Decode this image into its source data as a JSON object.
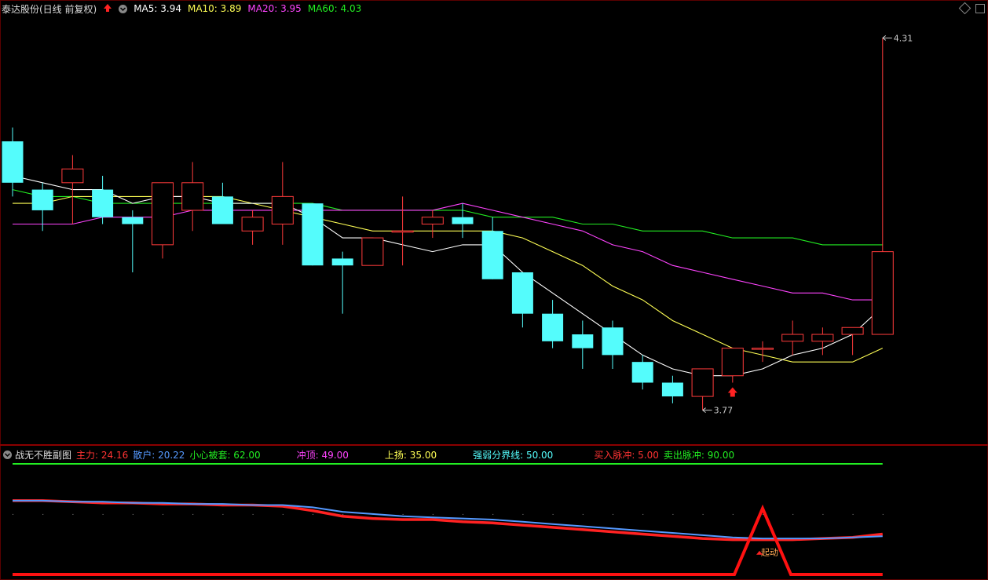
{
  "header": {
    "stock_title": "泰达股份(日线 前复权)",
    "ma5": "MA5: 3.94",
    "ma10": "MA10: 3.89",
    "ma20": "MA20: 3.95",
    "ma60": "MA60: 4.03",
    "colors": {
      "ma5": "#ffffff",
      "ma10": "#ffff55",
      "ma20": "#ff44ff",
      "ma60": "#22ee22"
    }
  },
  "main_chart": {
    "high_label": "4.31",
    "low_label": "3.77"
  },
  "sub_panel": {
    "title": "战无不胜副图",
    "indicators": [
      {
        "text": "主力: 24.16",
        "color": "#ff3333"
      },
      {
        "text": "散户: 20.22",
        "color": "#5599ff"
      },
      {
        "text": "小心被套: 62.00",
        "color": "#22ee22"
      },
      {
        "text": "冲顶: 49.00",
        "color": "#ff44ff"
      },
      {
        "text": "上扬: 35.00",
        "color": "#ffff55"
      },
      {
        "text": "强弱分界线: 50.00",
        "color": "#55ffff"
      },
      {
        "text": "买入脉冲: 5.00",
        "color": "#ff3333"
      },
      {
        "text": "卖出脉冲: 90.00",
        "color": "#22ee22"
      }
    ],
    "signal_label": "起动"
  },
  "chart_data": {
    "type": "candlestick",
    "candles": [
      {
        "o": 4.16,
        "h": 4.18,
        "l": 4.08,
        "c": 4.1
      },
      {
        "o": 4.09,
        "h": 4.1,
        "l": 4.03,
        "c": 4.06
      },
      {
        "o": 4.1,
        "h": 4.14,
        "l": 4.04,
        "c": 4.12
      },
      {
        "o": 4.09,
        "h": 4.11,
        "l": 4.04,
        "c": 4.05
      },
      {
        "o": 4.05,
        "h": 4.06,
        "l": 3.97,
        "c": 4.04
      },
      {
        "o": 4.01,
        "h": 4.07,
        "l": 3.99,
        "c": 4.1
      },
      {
        "o": 4.06,
        "h": 4.13,
        "l": 4.03,
        "c": 4.1
      },
      {
        "o": 4.08,
        "h": 4.1,
        "l": 4.04,
        "c": 4.04
      },
      {
        "o": 4.03,
        "h": 4.06,
        "l": 4.01,
        "c": 4.05
      },
      {
        "o": 4.04,
        "h": 4.13,
        "l": 4.01,
        "c": 4.08
      },
      {
        "o": 4.07,
        "h": 4.07,
        "l": 3.98,
        "c": 3.98
      },
      {
        "o": 3.99,
        "h": 4.0,
        "l": 3.91,
        "c": 3.98
      },
      {
        "o": 3.98,
        "h": 4.01,
        "l": 3.98,
        "c": 4.02
      },
      {
        "o": 4.03,
        "h": 4.08,
        "l": 3.98,
        "c": 4.03
      },
      {
        "o": 4.04,
        "h": 4.06,
        "l": 4.02,
        "c": 4.05
      },
      {
        "o": 4.05,
        "h": 4.07,
        "l": 4.02,
        "c": 4.04
      },
      {
        "o": 4.03,
        "h": 4.05,
        "l": 3.96,
        "c": 3.96
      },
      {
        "o": 3.97,
        "h": 3.97,
        "l": 3.89,
        "c": 3.91
      },
      {
        "o": 3.91,
        "h": 3.93,
        "l": 3.86,
        "c": 3.87
      },
      {
        "o": 3.88,
        "h": 3.9,
        "l": 3.83,
        "c": 3.86
      },
      {
        "o": 3.89,
        "h": 3.9,
        "l": 3.83,
        "c": 3.85
      },
      {
        "o": 3.84,
        "h": 3.85,
        "l": 3.8,
        "c": 3.81
      },
      {
        "o": 3.81,
        "h": 3.82,
        "l": 3.78,
        "c": 3.79
      },
      {
        "o": 3.79,
        "h": 3.83,
        "l": 3.77,
        "c": 3.83
      },
      {
        "o": 3.82,
        "h": 3.86,
        "l": 3.81,
        "c": 3.86
      },
      {
        "o": 3.86,
        "h": 3.87,
        "l": 3.84,
        "c": 3.86
      },
      {
        "o": 3.87,
        "h": 3.9,
        "l": 3.85,
        "c": 3.88
      },
      {
        "o": 3.87,
        "h": 3.89,
        "l": 3.85,
        "c": 3.88
      },
      {
        "o": 3.88,
        "h": 3.89,
        "l": 3.85,
        "c": 3.89
      },
      {
        "o": 3.88,
        "h": 4.31,
        "l": 3.88,
        "c": 4.0
      }
    ],
    "ma5": [
      4.11,
      4.1,
      4.09,
      4.09,
      4.07,
      4.08,
      4.08,
      4.07,
      4.07,
      4.07,
      4.05,
      4.02,
      4.02,
      4.01,
      4.0,
      4.01,
      4.01,
      3.97,
      3.94,
      3.91,
      3.88,
      3.85,
      3.83,
      3.82,
      3.82,
      3.83,
      3.85,
      3.86,
      3.88,
      3.92
    ],
    "ma10": [
      4.07,
      4.07,
      4.08,
      4.08,
      4.08,
      4.08,
      4.08,
      4.08,
      4.07,
      4.06,
      4.05,
      4.04,
      4.03,
      4.03,
      4.03,
      4.03,
      4.03,
      4.02,
      4.0,
      3.98,
      3.95,
      3.93,
      3.9,
      3.88,
      3.86,
      3.85,
      3.84,
      3.84,
      3.84,
      3.86
    ],
    "ma20": [
      4.04,
      4.04,
      4.04,
      4.05,
      4.05,
      4.05,
      4.06,
      4.06,
      4.06,
      4.06,
      4.06,
      4.06,
      4.06,
      4.06,
      4.06,
      4.07,
      4.06,
      4.05,
      4.04,
      4.03,
      4.01,
      4.0,
      3.98,
      3.97,
      3.96,
      3.95,
      3.94,
      3.94,
      3.93,
      3.93
    ],
    "ma60": [
      4.09,
      4.08,
      4.08,
      4.07,
      4.07,
      4.07,
      4.07,
      4.07,
      4.07,
      4.07,
      4.07,
      4.06,
      4.06,
      4.06,
      4.06,
      4.06,
      4.05,
      4.05,
      4.05,
      4.04,
      4.04,
      4.03,
      4.03,
      4.03,
      4.02,
      4.02,
      4.02,
      4.01,
      4.01,
      4.01
    ],
    "ylim": [
      3.74,
      4.34
    ],
    "sub": {
      "ylim": [
        0,
        100
      ],
      "zhuli": [
        67,
        67,
        66,
        65,
        65,
        64,
        64,
        63,
        63,
        62,
        58,
        53,
        51,
        50,
        50,
        48,
        47,
        45,
        43,
        41,
        39,
        37,
        35,
        33,
        32,
        32,
        32,
        33,
        34,
        37
      ],
      "sanhu": [
        67,
        67,
        66,
        66,
        65,
        65,
        64,
        64,
        63,
        63,
        61,
        57,
        55,
        53,
        52,
        51,
        50,
        48,
        46,
        44,
        42,
        40,
        38,
        36,
        34,
        33,
        33,
        33,
        34,
        35
      ],
      "pulse": [
        0,
        0,
        0,
        0,
        0,
        0,
        0,
        0,
        0,
        0,
        0,
        0,
        0,
        0,
        0,
        0,
        0,
        0,
        0,
        0,
        0,
        0,
        0,
        0,
        0,
        60,
        0,
        0,
        0,
        0
      ]
    }
  }
}
